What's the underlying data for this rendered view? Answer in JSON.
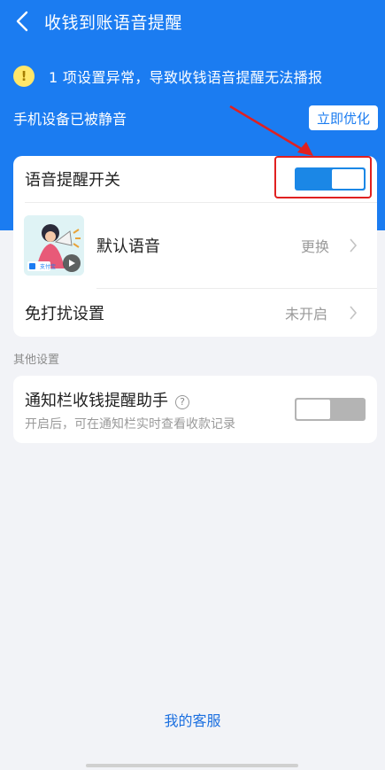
{
  "header": {
    "title": "收钱到账语音提醒"
  },
  "warning": {
    "text": "1 项设置异常，导致收钱语音提醒无法播报"
  },
  "device_status": {
    "text": "手机设备已被静音",
    "action_label": "立即优化"
  },
  "voice_settings": {
    "switch_label": "语音提醒开关",
    "switch_on": true,
    "default_voice_label": "默认语音",
    "default_voice_action": "更换",
    "thumb_brand": "支付宝",
    "dnd_label": "免打扰设置",
    "dnd_value": "未开启"
  },
  "other": {
    "section_title": "其他设置",
    "assistant_label": "通知栏收钱提醒助手",
    "assistant_help": "?",
    "assistant_desc": "开启后，可在通知栏实时查看收款记录",
    "assistant_on": false
  },
  "footer": {
    "link": "我的客服"
  },
  "colors": {
    "primary": "#1b7cf1",
    "alert_border": "#e02020"
  }
}
